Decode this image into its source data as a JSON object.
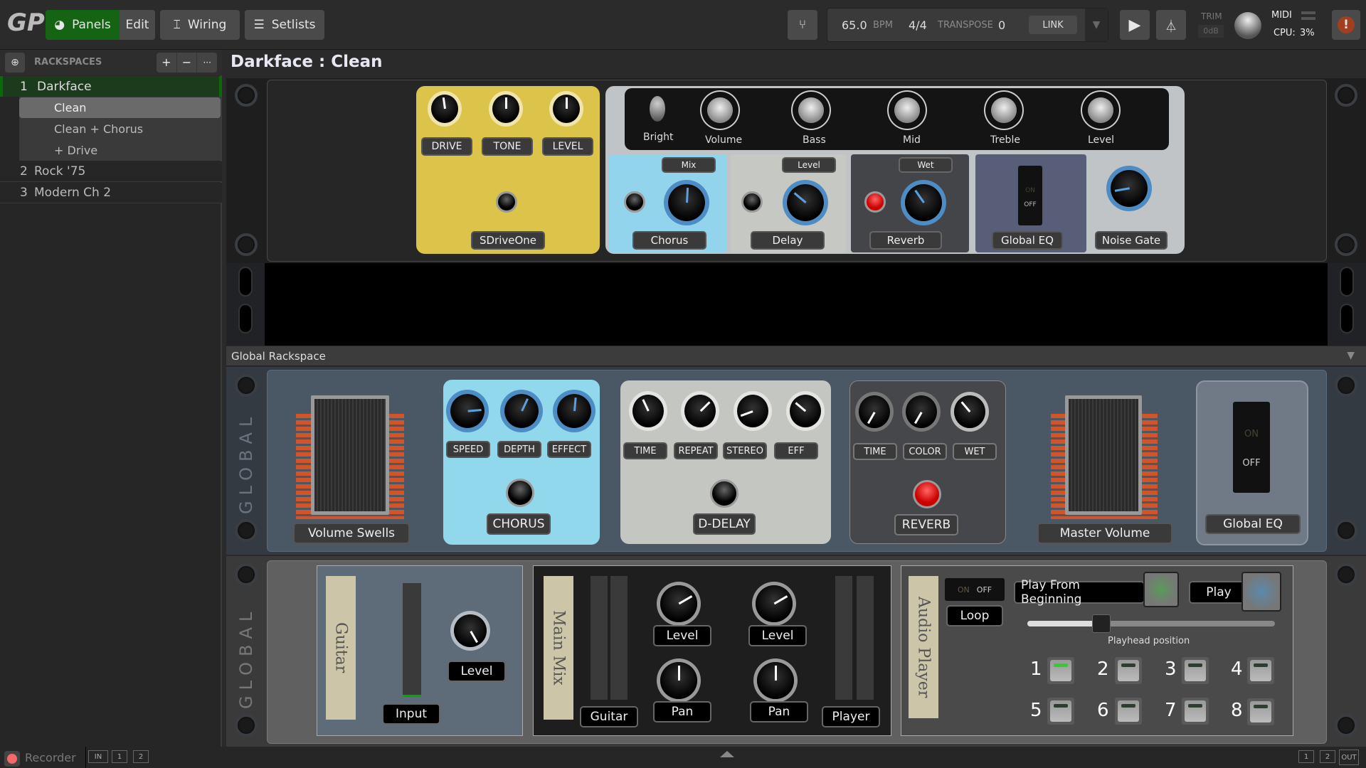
{
  "topbar": {
    "logo": "GP",
    "panels_label": "Panels",
    "edit_label": "Edit",
    "wiring_label": "Wiring",
    "setlists_label": "Setlists",
    "tempo": "65.0",
    "tempo_unit": "BPM",
    "time_signature": "4/4",
    "transpose_label": "TRANSPOSE",
    "transpose_value": "0",
    "link_label": "LINK",
    "trim_label": "TRIM",
    "trim_value": "0dB",
    "midi_label": "MIDI",
    "cpu_label": "CPU:",
    "cpu_value": "3%",
    "alert_icon": "!"
  },
  "sidebar": {
    "header": "RACKSPACES",
    "add": "+",
    "remove": "−",
    "more": "···",
    "rackspaces": [
      {
        "num": "1",
        "name": "Darkface",
        "variations": [
          "Clean",
          "Clean + Chorus",
          "+ Drive"
        ],
        "active": true,
        "selected_variation": 0
      },
      {
        "num": "2",
        "name": "Rock '75"
      },
      {
        "num": "3",
        "name": "Modern Ch 2"
      }
    ]
  },
  "main": {
    "title": "Darkface : Clean",
    "sdrive": {
      "knobs": [
        "DRIVE",
        "TONE",
        "LEVEL"
      ],
      "name": "SDriveOne"
    },
    "amp": {
      "labels": [
        "Bright",
        "Volume",
        "Bass",
        "Mid",
        "Treble",
        "Level"
      ]
    },
    "fx": [
      {
        "top": "Mix",
        "name": "Chorus"
      },
      {
        "top": "Level",
        "name": "Delay"
      },
      {
        "top": "Wet",
        "name": "Reverb"
      },
      {
        "name": "Global EQ",
        "switch_on": "ON",
        "switch_off": "OFF"
      },
      {
        "name": "Noise Gate"
      }
    ]
  },
  "global": {
    "header": "Global Rackspace",
    "side_label": "GLOBAL",
    "volume_swells": "Volume Swells",
    "chorus": {
      "knobs": [
        "SPEED",
        "DEPTH",
        "EFFECT"
      ],
      "name": "CHORUS"
    },
    "delay": {
      "knobs": [
        "TIME",
        "REPEAT",
        "STEREO",
        "EFF"
      ],
      "name": "D-DELAY"
    },
    "reverb": {
      "knobs": [
        "TIME",
        "COLOR",
        "WET"
      ],
      "name": "REVERB"
    },
    "master_volume": "Master Volume",
    "global_eq": {
      "name": "Global EQ",
      "on": "ON",
      "off": "OFF"
    },
    "guitar": {
      "tape": "Guitar",
      "input": "Input",
      "level": "Level"
    },
    "mainmix": {
      "tape": "Main Mix",
      "guitar": "Guitar",
      "player": "Player",
      "level1": "Level",
      "level2": "Level",
      "pan1": "Pan",
      "pan2": "Pan"
    },
    "player": {
      "tape": "Audio Player",
      "loop_on": "ON",
      "loop_off": "OFF",
      "loop": "Loop",
      "play_from_beginning": "Play From Beginning",
      "play": "Play",
      "playhead_label": "Playhead position",
      "playhead_position": 0.3,
      "pads": [
        "1",
        "2",
        "3",
        "4",
        "5",
        "6",
        "7",
        "8"
      ],
      "active_pad": 0
    }
  },
  "statusbar": {
    "recorder": "Recorder",
    "in_label": "IN",
    "in1": "1",
    "in2": "2",
    "out1": "1",
    "out2": "2",
    "out_label": "OUT"
  }
}
